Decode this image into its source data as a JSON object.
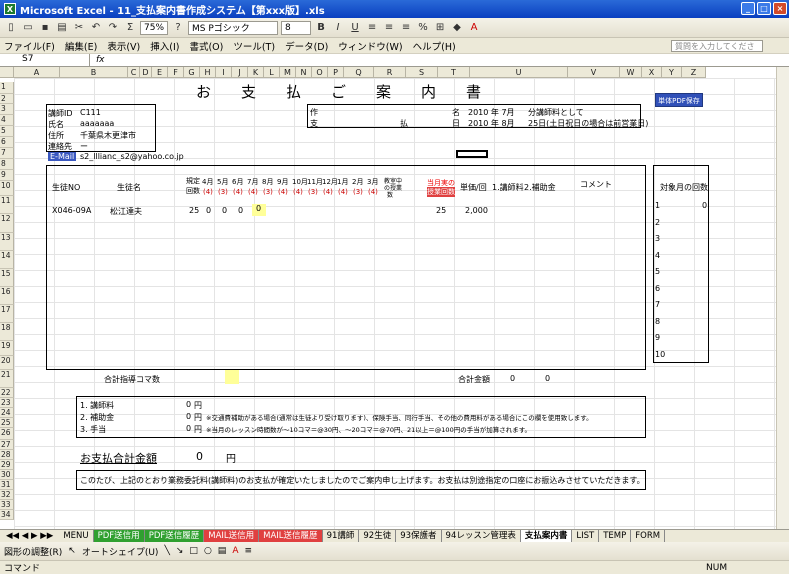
{
  "window": {
    "title": "Microsoft Excel - 11_支払案内書作成システム【第xxx版】.xls"
  },
  "toolbar": {
    "zoom": "75%",
    "font": "MS Pゴシック",
    "size": "8",
    "bold": "B",
    "italic": "I",
    "underline": "U"
  },
  "menu": [
    "ファイル(F)",
    "編集(E)",
    "表示(V)",
    "挿入(I)",
    "書式(O)",
    "ツール(T)",
    "データ(D)",
    "ウィンドウ(W)",
    "ヘルプ(H)"
  ],
  "help_placeholder": "質問を入力してください",
  "formula": {
    "cell": "S7",
    "fx": "fx"
  },
  "columns": [
    "A",
    "B",
    "C",
    "D",
    "E",
    "F",
    "G",
    "H",
    "I",
    "J",
    "K",
    "L",
    "M",
    "N",
    "O",
    "P",
    "Q",
    "R",
    "S",
    "T",
    "U",
    "V",
    "W",
    "X",
    "Y",
    "Z",
    "AA"
  ],
  "rows": [
    "1",
    "2",
    "3",
    "4",
    "5",
    "6",
    "7",
    "8",
    "9",
    "10",
    "11",
    "12",
    "13",
    "14",
    "15",
    "16",
    "17",
    "18",
    "19",
    "20",
    "21",
    "22",
    "23",
    "24",
    "25",
    "26",
    "27",
    "28",
    "29",
    "30",
    "31",
    "32",
    "33",
    "34"
  ],
  "sheet": {
    "title": "お　　支　　払　　ご　　案　　内　　書",
    "labels": {
      "id": "講師ID",
      "name": "氏名",
      "address": "住所",
      "contact": "連絡先",
      "email": "E-Mail"
    },
    "values": {
      "id": "C111",
      "name": "aaaaaaa",
      "address": "千葉県木更津市",
      "contact": "ー",
      "email": "s2_lllianc_s2@yahoo.co.jp"
    },
    "right_block": {
      "r1a": "作",
      "r1b": "名",
      "r1c": "2010 年 7月",
      "r1d": "分講師料として",
      "r2a": "支",
      "r2b": "払",
      "r2c": "日",
      "r2d": "2010 年 8月",
      "r2e": "25日(土日祝日の場合は前営業日)"
    },
    "pdf_button": "単体PDF保存",
    "header": {
      "id": "生徒NO",
      "name": "生徒名",
      "koma": "規定回数",
      "months": [
        "4月",
        "5月",
        "6月",
        "7月",
        "8月",
        "9月",
        "10月",
        "11月",
        "12月",
        "1月",
        "2月",
        "3月"
      ],
      "codes": [
        "(4)",
        "(3)",
        "(4)",
        "(4)",
        "(3)",
        "(4)",
        "(4)",
        "(3)",
        "(4)",
        "(4)",
        "(3)",
        "(4)"
      ],
      "kyou": "教室中",
      "kyou2": "の授業",
      "kyou3": "数",
      "total": "当月実の",
      "total2": "授業回数",
      "unit": "単価/回",
      "fee": "1.講師料",
      "assist": "2.補助金",
      "comment": "コメント",
      "target": "対象月の回数"
    },
    "row1": {
      "id": "X046-09A",
      "name": "松江達夫",
      "koma": "25",
      "m1": "0",
      "m2": "0",
      "m3": "0",
      "m4": "0",
      "tot": "25",
      "unit": "2,000"
    },
    "target_rows": [
      "1",
      "2",
      "3",
      "4",
      "5",
      "6",
      "7",
      "8",
      "9",
      "10"
    ],
    "target_val": "0",
    "sum_label": "合計指導コマ数",
    "total_label": "合計金額",
    "total_fee": "0",
    "total_assist": "0",
    "items": [
      {
        "label": "1. 講師料",
        "amount": "0",
        "unit": "円",
        "note": ""
      },
      {
        "label": "2. 補助金",
        "amount": "0",
        "unit": "円",
        "note": "※交通費補助がある場合(通常は生徒より受け取ります)、保険手当、同行手当、その他の費用料がある場合にこの欄を使用致します。"
      },
      {
        "label": "3. 手当",
        "amount": "0",
        "unit": "円",
        "note": "※当月のレッスン時間数が～10コマ＝@30円、～20コマ＝@70円、21以上＝@100円の手当が加算されます。"
      }
    ],
    "grand_label": "お支払合計金額",
    "grand_value": "0",
    "grand_unit": "円",
    "message": "このたび、上記のとおり業務委託料(講師料)のお支払が確定いたしましたのでご案内申し上げます。お支払は別途指定の口座にお振込みさせていただきます。"
  },
  "tabs": [
    {
      "label": "MENU",
      "style": "plain"
    },
    {
      "label": "PDF送信用",
      "style": "green"
    },
    {
      "label": "PDF送信履歴",
      "style": "green"
    },
    {
      "label": "MAIL送信用",
      "style": "red"
    },
    {
      "label": "MAIL送信履歴",
      "style": "red"
    },
    {
      "label": "91講師",
      "style": "plain"
    },
    {
      "label": "92生徒",
      "style": "plain"
    },
    {
      "label": "93保護者",
      "style": "plain"
    },
    {
      "label": "94レッスン管理表",
      "style": "plain"
    },
    {
      "label": "支払案内書",
      "style": "active"
    },
    {
      "label": "LIST",
      "style": "plain"
    },
    {
      "label": "TEMP",
      "style": "plain"
    },
    {
      "label": "FORM",
      "style": "plain"
    }
  ],
  "drawbar": {
    "adjust": "図形の調整(R)",
    "autoshape": "オートシェイプ(U)"
  },
  "status": {
    "mode": "コマンド",
    "num": "NUM"
  }
}
